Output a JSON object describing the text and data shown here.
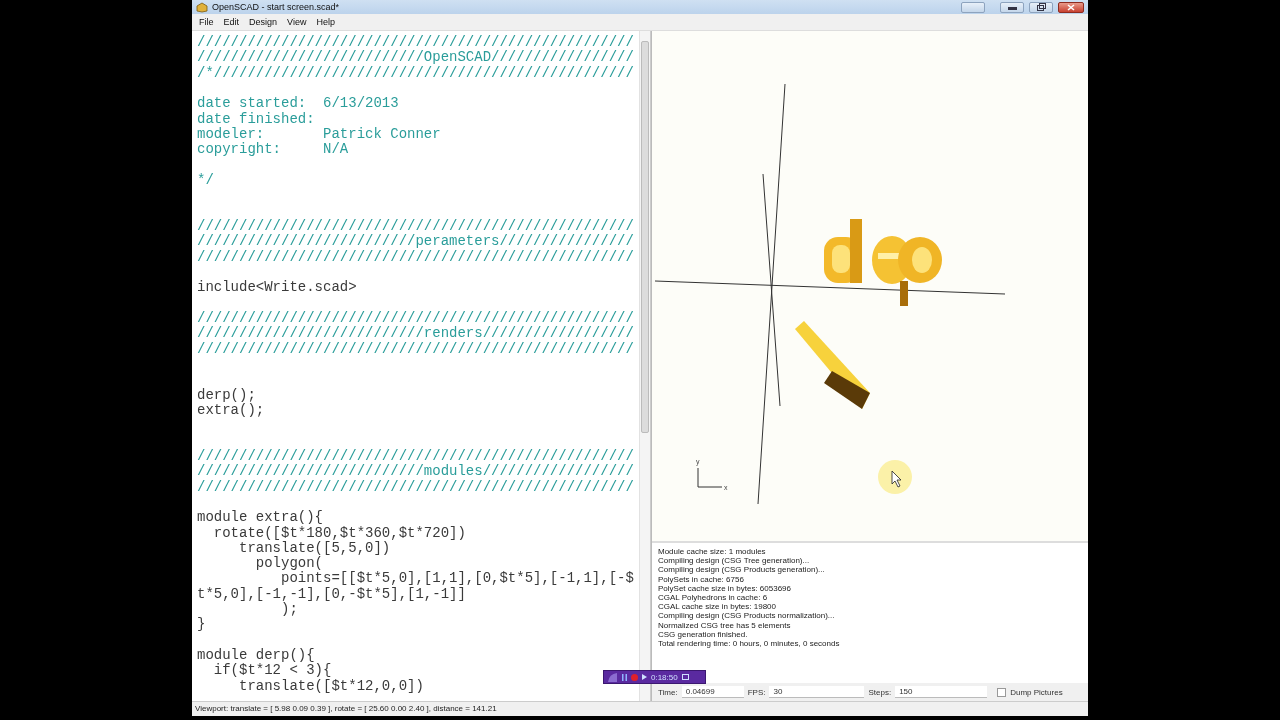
{
  "window": {
    "title": "OpenSCAD - start screen.scad*"
  },
  "menu": [
    "File",
    "Edit",
    "Design",
    "View",
    "Help"
  ],
  "editor": {
    "lines": [
      {
        "kind": "comment",
        "text": "////////////////////////////////////////////////////"
      },
      {
        "kind": "comment",
        "text": "///////////////////////////OpenSCAD/////////////////"
      },
      {
        "kind": "comment",
        "text": "/*//////////////////////////////////////////////////"
      },
      {
        "kind": "blank"
      },
      {
        "kind": "comment",
        "text": "date started:  6/13/2013"
      },
      {
        "kind": "comment",
        "text": "date finished:"
      },
      {
        "kind": "comment",
        "text": "modeler:       Patrick Conner"
      },
      {
        "kind": "comment",
        "text": "copyright:     N/A"
      },
      {
        "kind": "blank"
      },
      {
        "kind": "comment",
        "text": "*/"
      },
      {
        "kind": "blank"
      },
      {
        "kind": "blank"
      },
      {
        "kind": "comment",
        "text": "////////////////////////////////////////////////////"
      },
      {
        "kind": "comment",
        "text": "//////////////////////////perameters////////////////"
      },
      {
        "kind": "comment",
        "text": "////////////////////////////////////////////////////"
      },
      {
        "kind": "blank"
      },
      {
        "kind": "code",
        "text": "include<Write.scad>"
      },
      {
        "kind": "blank"
      },
      {
        "kind": "comment",
        "text": "////////////////////////////////////////////////////"
      },
      {
        "kind": "comment",
        "text": "///////////////////////////renders//////////////////"
      },
      {
        "kind": "comment",
        "text": "////////////////////////////////////////////////////"
      },
      {
        "kind": "blank"
      },
      {
        "kind": "blank"
      },
      {
        "kind": "code",
        "text": "derp();"
      },
      {
        "kind": "code",
        "text": "extra();"
      },
      {
        "kind": "blank"
      },
      {
        "kind": "blank"
      },
      {
        "kind": "comment",
        "text": "////////////////////////////////////////////////////"
      },
      {
        "kind": "comment",
        "text": "///////////////////////////modules//////////////////"
      },
      {
        "kind": "comment",
        "text": "////////////////////////////////////////////////////"
      },
      {
        "kind": "blank"
      },
      {
        "kind": "code",
        "text": "module extra(){"
      },
      {
        "kind": "code",
        "text": "  rotate([$t*180,$t*360,$t*720])"
      },
      {
        "kind": "code",
        "text": "     translate([5,5,0])"
      },
      {
        "kind": "code",
        "text": "       polygon("
      },
      {
        "kind": "code",
        "text": "          points=[[$t*5,0],[1,1],[0,$t*5],[-1,1],[-$"
      },
      {
        "kind": "code",
        "text": "t*5,0],[-1,-1],[0,-$t*5],[1,-1]]"
      },
      {
        "kind": "code",
        "text": "          );"
      },
      {
        "kind": "code",
        "text": "}"
      },
      {
        "kind": "blank"
      },
      {
        "kind": "code",
        "text": "module derp(){"
      },
      {
        "kind": "code",
        "text": "  if($t*12 < 3){"
      },
      {
        "kind": "code",
        "text": "     translate([$t*12,0,0])"
      }
    ]
  },
  "viewer": {
    "axis_gizmo": {
      "y_label": "y",
      "x_label": "x"
    }
  },
  "console": {
    "lines": [
      "Module cache size: 1 modules",
      "Compiling design (CSG Tree generation)...",
      "Compiling design (CSG Products generation)...",
      "PolySets in cache: 6756",
      "PolySet cache size in bytes: 6053696",
      "CGAL Polyhedrons in cache: 6",
      "CGAL cache size in bytes: 19800",
      "Compiling design (CSG Products normalization)...",
      "Normalized CSG tree has 5 elements",
      "CSG generation finished.",
      "Total rendering time: 0 hours, 0 minutes, 0 seconds"
    ]
  },
  "animation": {
    "time_label": "Time:",
    "time_value": "0.04699",
    "fps_label": "FPS:",
    "fps_value": "30",
    "steps_label": "Steps:",
    "steps_value": "150",
    "dump_pictures": {
      "label": "Dump Pictures",
      "checked": false
    }
  },
  "status_bar": "Viewport: translate = [ 5.98 0.09 0.39 ], rotate = [ 25.60 0.00 2.40 ], distance = 141.21",
  "recorder": {
    "time": "0:18:50"
  }
}
